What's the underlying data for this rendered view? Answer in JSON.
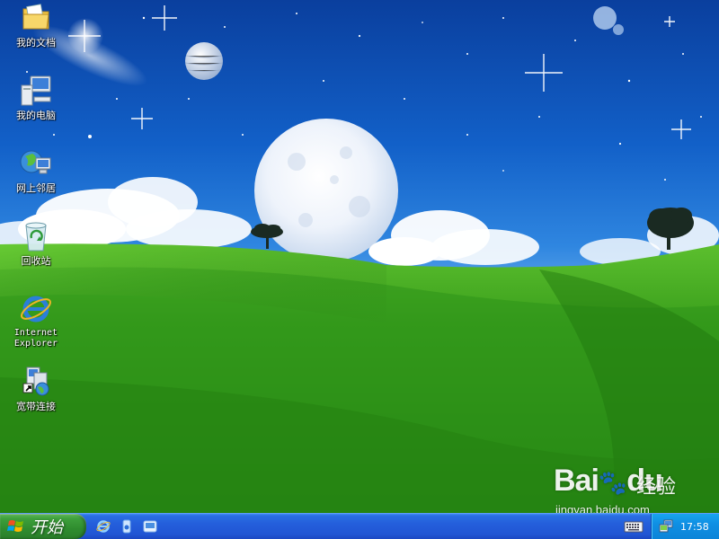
{
  "desktop": {
    "icons": [
      {
        "label": "我的文档",
        "icon": "my-documents-folder-icon"
      },
      {
        "label": "我的电脑",
        "icon": "my-computer-icon"
      },
      {
        "label": "网上邻居",
        "icon": "network-places-icon"
      },
      {
        "label": "回收站",
        "icon": "recycle-bin-icon"
      },
      {
        "label": "Internet\nExplorer",
        "icon": "internet-explorer-icon"
      },
      {
        "label": "宽带连接",
        "icon": "broadband-connection-icon"
      }
    ]
  },
  "watermark": {
    "brand": "Bai",
    "brand_suffix": "du",
    "chinese": "经验",
    "url": "jingyan.baidu.com"
  },
  "taskbar": {
    "start_label": "开始",
    "quick_launch": [
      "internet-explorer-icon",
      "media-player-icon",
      "show-desktop-icon"
    ],
    "tray": {
      "ime_icon": "keyboard-icon",
      "network_icon": "network-status-icon",
      "clock": "17:58"
    }
  },
  "colors": {
    "taskbar_blue": "#245edb",
    "start_green": "#3d9f3b",
    "tray_blue": "#0f8fe3",
    "sky_top": "#0a3f9e",
    "grass": "#2f9a1e"
  }
}
